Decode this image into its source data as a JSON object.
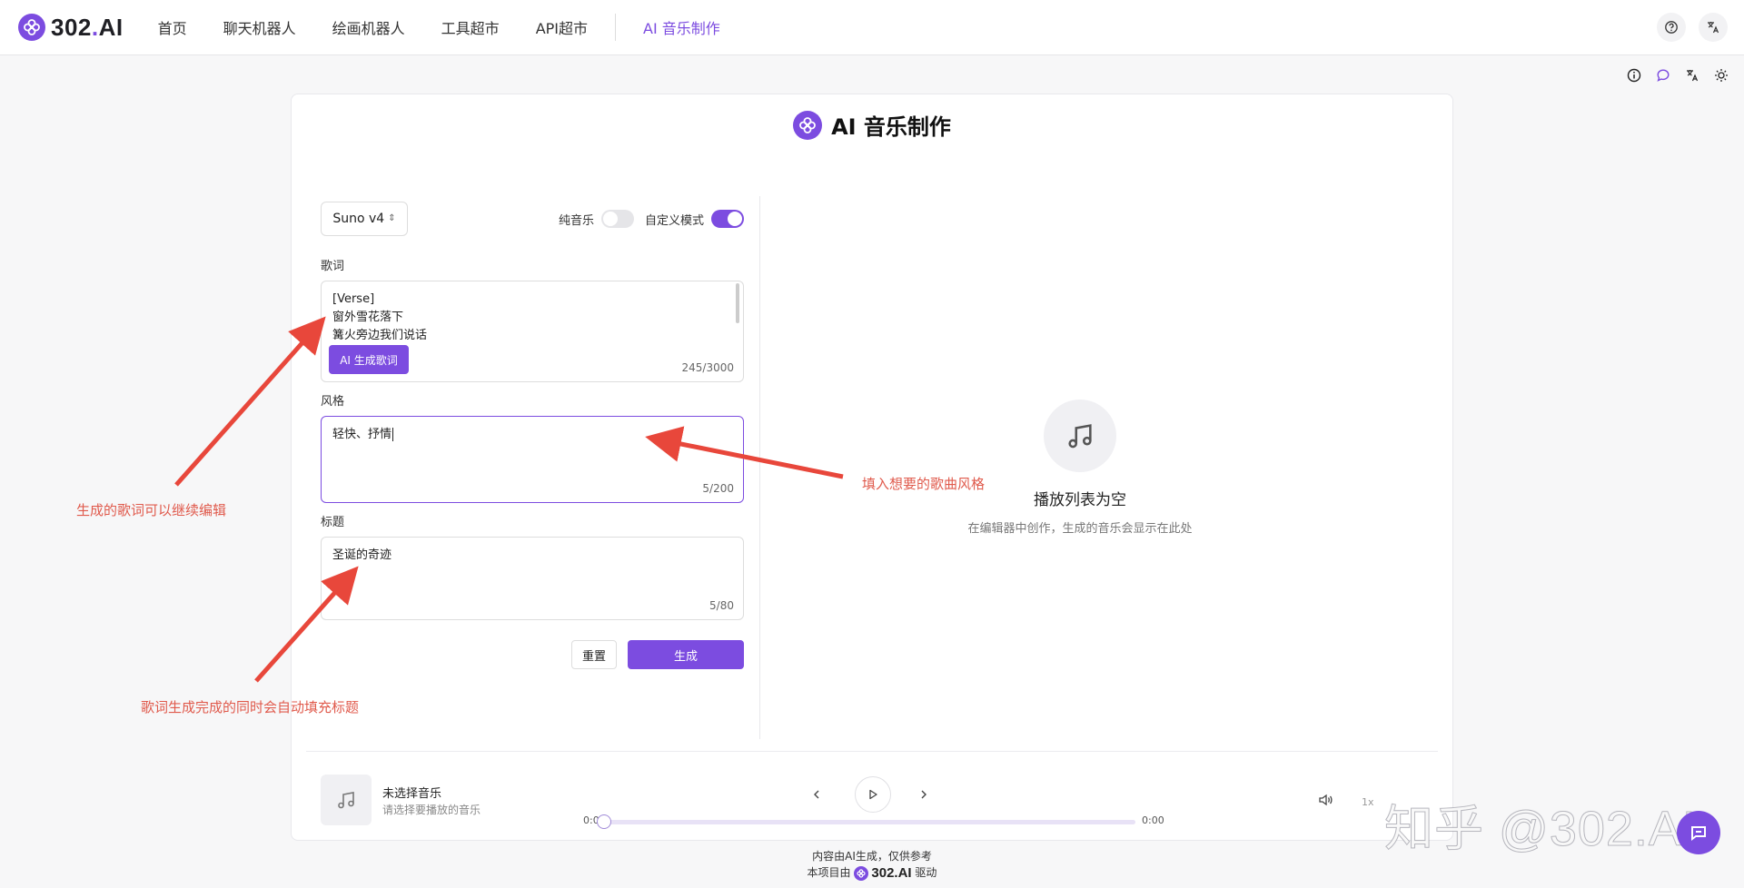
{
  "nav": {
    "logo_main": "302",
    "logo_dot": ".",
    "logo_suffix": "AI",
    "items": [
      "首页",
      "聊天机器人",
      "绘画机器人",
      "工具超市",
      "API超市"
    ],
    "active": "AI 音乐制作"
  },
  "page": {
    "title": "AI 音乐制作"
  },
  "form": {
    "model": "Suno v4",
    "pure_music_label": "纯音乐",
    "custom_mode_label": "自定义模式",
    "pure_music_on": false,
    "custom_mode_on": true,
    "lyrics_label": "歌词",
    "lyrics_value": "[Verse]\n窗外雪花落下\n篝火旁边我们说话",
    "lyrics_counter": "245/3000",
    "ai_lyrics_button": "AI 生成歌词",
    "style_label": "风格",
    "style_value": "轻快、抒情",
    "style_counter": "5/200",
    "title_label": "标题",
    "title_value": "圣诞的奇迹",
    "title_counter": "5/80",
    "reset_button": "重置",
    "generate_button": "生成"
  },
  "playlist": {
    "empty_title": "播放列表为空",
    "empty_hint": "在编辑器中创作，生成的音乐会显示在此处"
  },
  "player": {
    "song_title": "未选择音乐",
    "song_sub": "请选择要播放的音乐",
    "time_start": "0:00",
    "time_end": "0:00",
    "speed": "1x",
    "progress": 0
  },
  "footer": {
    "line1": "内容由AI生成，仅供参考",
    "line2_prefix": "本项目由",
    "line2_brand": "302.AI",
    "line2_suffix": "驱动"
  },
  "annotations": {
    "lyrics_edit": "生成的歌词可以继续编辑",
    "style_fill": "填入想要的歌曲风格",
    "auto_title": "歌词生成完成的同时会自动填充标题"
  },
  "watermark": "知乎 @302.AI",
  "colors": {
    "accent": "#7c4ce0",
    "annotation": "#e05a4c"
  }
}
